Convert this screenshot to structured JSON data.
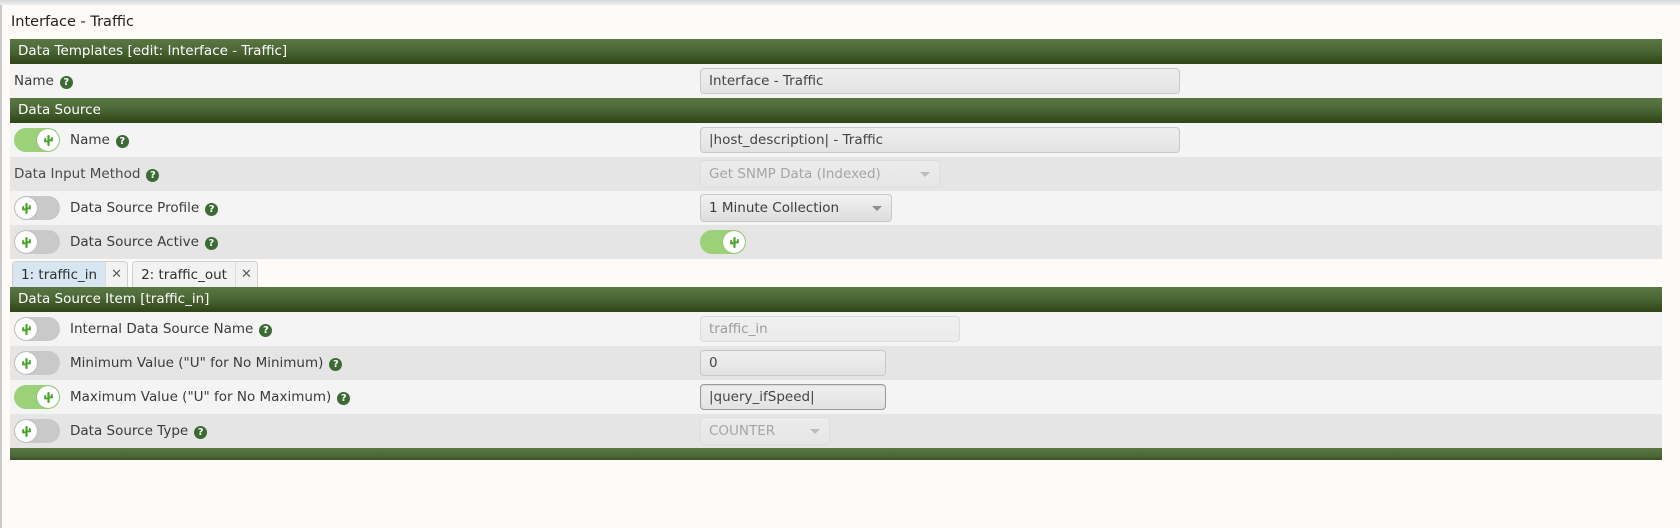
{
  "page": {
    "title": "Interface - Traffic"
  },
  "sections": {
    "data_templates": {
      "header": "Data Templates [edit: Interface - Traffic]",
      "name_label": "Name",
      "name_value": "Interface - Traffic"
    },
    "data_source": {
      "header": "Data Source",
      "rows": [
        {
          "label": "Name",
          "toggle": "on",
          "field": "text",
          "value": "|host_description| - Traffic",
          "state": "normal"
        },
        {
          "label": "Data Input Method",
          "toggle": "none",
          "field": "select",
          "value": "Get SNMP Data (Indexed)",
          "state": "disabled"
        },
        {
          "label": "Data Source Profile",
          "toggle": "off",
          "field": "select",
          "value": "1 Minute Collection",
          "state": "normal"
        },
        {
          "label": "Data Source Active",
          "toggle": "off",
          "field": "toggle",
          "value": "on",
          "state": "normal"
        }
      ]
    },
    "data_source_item": {
      "header": "Data Source Item [traffic_in]",
      "rows": [
        {
          "label": "Internal Data Source Name",
          "toggle": "off",
          "field": "text",
          "value": "traffic_in",
          "state": "readonly"
        },
        {
          "label": "Minimum Value (\"U\" for No Minimum)",
          "toggle": "off",
          "field": "text",
          "value": "0",
          "state": "normal"
        },
        {
          "label": "Maximum Value (\"U\" for No Maximum)",
          "toggle": "on",
          "field": "text",
          "value": "|query_ifSpeed|",
          "state": "focused"
        },
        {
          "label": "Data Source Type",
          "toggle": "off",
          "field": "select",
          "value": "COUNTER",
          "state": "disabled"
        }
      ]
    }
  },
  "tabs": [
    {
      "label": "1: traffic_in",
      "close": "✕",
      "active": true
    },
    {
      "label": "2: traffic_out",
      "close": "✕",
      "active": false
    }
  ],
  "icons": {
    "help": "?"
  },
  "colors": {
    "header_green_top": "#5a7742",
    "header_green_bottom": "#2e4516",
    "toggle_on": "#9bd179",
    "toggle_off": "#c9c9c9",
    "help_icon": "#3b6b33",
    "tab_active": "#d7e6f0"
  }
}
